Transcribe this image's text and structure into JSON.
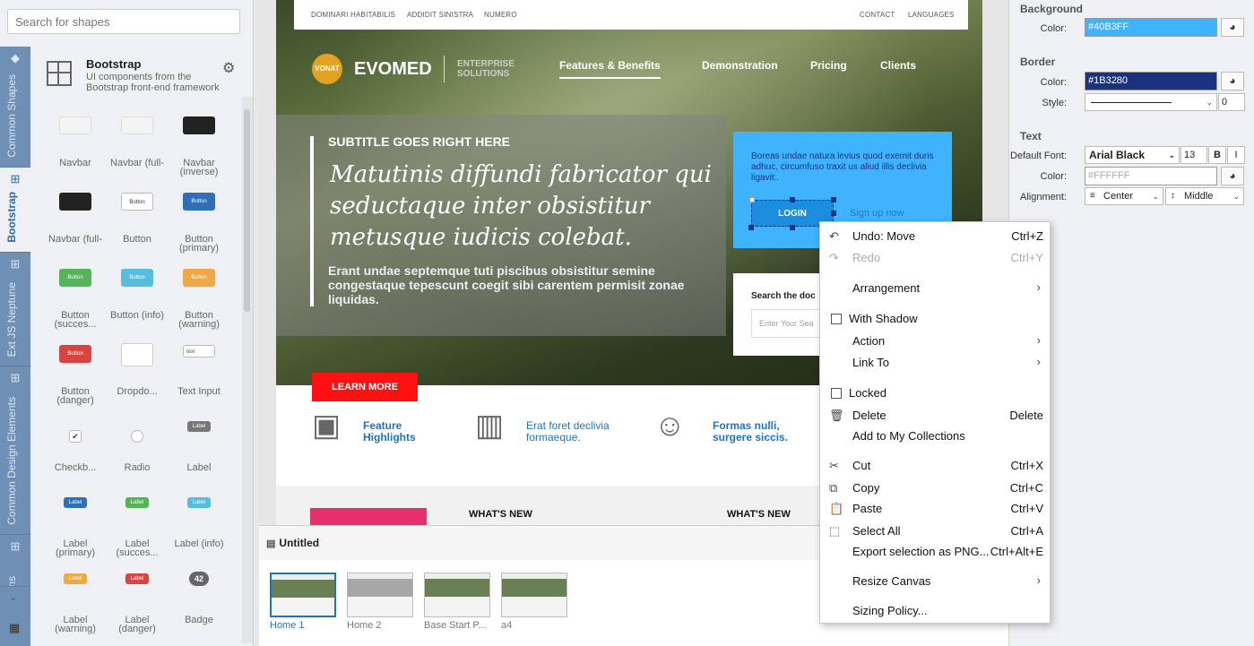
{
  "left_panel": {
    "search_placeholder": "Search for shapes",
    "vertical_tabs": [
      {
        "label": "Common Shapes",
        "icon": "layers-icon"
      },
      {
        "label": "Bootstrap",
        "icon": "grid-icon"
      },
      {
        "label": "Ext JS Neptune",
        "icon": "grid-icon"
      },
      {
        "label": "Common Design Elements",
        "icon": "grid-icon"
      },
      {
        "label": "Icons",
        "icon": "grid-icon"
      }
    ],
    "library": {
      "title": "Bootstrap",
      "description": "UI components from the Bootstrap front-end framework"
    },
    "shapes": [
      {
        "label": "Navbar",
        "thumb": ""
      },
      {
        "label": "Navbar (full-",
        "thumb": ""
      },
      {
        "label": "Navbar (inverse)",
        "thumb": ""
      },
      {
        "label": "Navbar (full-",
        "thumb": ""
      },
      {
        "label": "Button",
        "thumb": "Button"
      },
      {
        "label": "Button (primary)",
        "thumb": "Button"
      },
      {
        "label": "Button (succes...",
        "thumb": "Button"
      },
      {
        "label": "Button (info)",
        "thumb": "Button"
      },
      {
        "label": "Button (warning)",
        "thumb": "Button"
      },
      {
        "label": "Button (danger)",
        "thumb": "Button"
      },
      {
        "label": "Dropdo...",
        "thumb": ""
      },
      {
        "label": "Text Input",
        "thumb": "text"
      },
      {
        "label": "Checkb...",
        "thumb": ""
      },
      {
        "label": "Radio",
        "thumb": ""
      },
      {
        "label": "Label",
        "thumb": "Label"
      },
      {
        "label": "Label (primary)",
        "thumb": "Label"
      },
      {
        "label": "Label (succes...",
        "thumb": "Label"
      },
      {
        "label": "Label (info)",
        "thumb": "Label"
      },
      {
        "label": "Label (warning)",
        "thumb": "Label"
      },
      {
        "label": "Label (danger)",
        "thumb": "Label"
      },
      {
        "label": "Badge",
        "thumb": "42"
      }
    ]
  },
  "canvas": {
    "topnav_left": [
      "DOMINARI HABITABILIS",
      "ADDIDIT SINISTRA",
      "NUMERO"
    ],
    "topnav_right": [
      "CONTACT",
      "LANGUAGES"
    ],
    "logo_text": "EVOMED",
    "logo_badge": "VONAT",
    "logo_sub": "ENTERPRISE SOLUTIONS",
    "main_nav": [
      "Features & Benefits",
      "Demonstration",
      "Pricing",
      "Clients"
    ],
    "hero_subtitle": "SUBTITLE GOES RIGHT HERE",
    "hero_script": "Matutinis diffundi fabricator qui seductaque inter obsistitur metusque iudicis colebat.",
    "hero_para": "Erant  undae septemque tuti piscibus obsistitur semine congestaque tepescunt coegit sibi carentem permisit zonae liquidas.",
    "blue_text": "Boreas undae natura levius quod exemit duris adhuc, circumfuso traxit us aliud illis declivia ligavit:.",
    "login_label": "LOGIN",
    "signup_label": "Sign up now",
    "search_title": "Search the doc",
    "search_placeholder": "Enter Your Sea",
    "learn_more": "LEARN MORE",
    "features": [
      {
        "text": "Feature Highlights",
        "icon": "profile-card-icon"
      },
      {
        "text": "Erat  foret declivia formaeque.",
        "icon": "bar-chart-icon"
      },
      {
        "text": "Formas nulli, surgere siccis.",
        "icon": "person-icon"
      }
    ],
    "whats_new": [
      "WHAT'S NEW",
      "WHAT'S NEW"
    ]
  },
  "pages": {
    "title": "Untitled",
    "items": [
      "Home 1",
      "Home 2",
      "Base Start P...",
      "a4"
    ]
  },
  "right_panel": {
    "background": {
      "heading": "Background",
      "color_label": "Color:",
      "color": "#40B3FF"
    },
    "border": {
      "heading": "Border",
      "color_label": "Color:",
      "color": "#1B3280",
      "style_label": "Style:",
      "width": "0"
    },
    "text": {
      "heading": "Text",
      "font_label": "Default Font:",
      "font": "Arial Black",
      "size": "13",
      "bold": "B",
      "italic": "I",
      "color_label": "Color:",
      "color_placeholder": "#FFFFFF",
      "align_label": "Alignment:",
      "h_align": "Center",
      "v_align": "Middle"
    }
  },
  "context_menu": [
    {
      "label": "Undo: Move",
      "shortcut": "Ctrl+Z",
      "icon": "undo-icon"
    },
    {
      "label": "Redo",
      "shortcut": "Ctrl+Y",
      "icon": "redo-icon",
      "disabled": true
    },
    {
      "label": "Arrangement",
      "submenu": true
    },
    {
      "label": "With Shadow",
      "checkbox": true
    },
    {
      "label": "Action",
      "submenu": true
    },
    {
      "label": "Link To",
      "submenu": true
    },
    {
      "label": "Locked",
      "checkbox": true
    },
    {
      "label": "Delete",
      "shortcut": "Delete",
      "icon": "trash-icon"
    },
    {
      "label": "Add to My Collections"
    },
    {
      "label": "Cut",
      "shortcut": "Ctrl+X",
      "icon": "scissors-icon"
    },
    {
      "label": "Copy",
      "shortcut": "Ctrl+C",
      "icon": "copy-icon"
    },
    {
      "label": "Paste",
      "shortcut": "Ctrl+V",
      "icon": "paste-icon"
    },
    {
      "label": "Select All",
      "shortcut": "Ctrl+A",
      "icon": "select-all-icon"
    },
    {
      "label": "Export selection as PNG...",
      "shortcut": "Ctrl+Alt+E"
    },
    {
      "label": "Resize Canvas",
      "submenu": true
    },
    {
      "label": "Sizing Policy..."
    }
  ],
  "colors": {
    "accent": "#1e73be",
    "sidebar_tabs": "#6f8fb5",
    "danger": "#ff1010"
  }
}
